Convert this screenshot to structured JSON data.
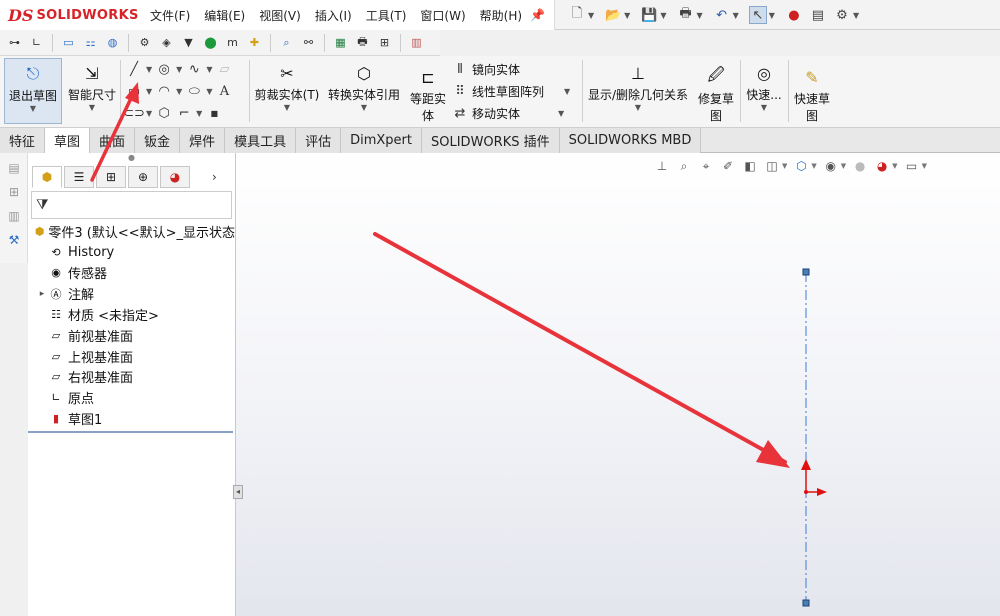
{
  "app": {
    "logo_mark": "DS",
    "logo_text": "SOLIDWORKS"
  },
  "menu": [
    "文件(F)",
    "编辑(E)",
    "视图(V)",
    "插入(I)",
    "工具(T)",
    "窗口(W)",
    "帮助(H)"
  ],
  "quick_access": [
    "new-document-icon",
    "open-icon",
    "save-icon",
    "print-icon",
    "undo-icon",
    "select-icon",
    "traffic-light-icon",
    "options-icon",
    "gear-icon"
  ],
  "toolbar2_icons": [
    "smart-dimension-icon",
    "sketch-icon",
    "monitor-icon",
    "tree-icon",
    "globe-icon",
    "gear-icon",
    "part-icon",
    "shadow-icon",
    "pin-icon",
    "graph-icon",
    "plus-icon",
    "zoom-icon",
    "binoculars-icon",
    "excel-icon",
    "print-icon",
    "add-icon",
    "document-icon"
  ],
  "command_manager": {
    "exit_sketch": "退出草图",
    "smart_dimension": "智能尺寸",
    "trim": "剪裁实体(T)",
    "convert": "转换实体引用",
    "offset_line1": "等距实",
    "offset_line2": "体",
    "mirror": "镜向实体",
    "linear_pattern": "线性草图阵列",
    "move": "移动实体",
    "display_relations": "显示/删除几何关系",
    "repair_line1": "修复草",
    "repair_line2": "图",
    "quick_snap": "快速...",
    "quick_sketch_line1": "快速草",
    "quick_sketch_line2": "图"
  },
  "tabs": [
    {
      "label": "特征",
      "active": false
    },
    {
      "label": "草图",
      "active": true
    },
    {
      "label": "曲面",
      "active": false
    },
    {
      "label": "钣金",
      "active": false
    },
    {
      "label": "焊件",
      "active": false
    },
    {
      "label": "模具工具",
      "active": false
    },
    {
      "label": "评估",
      "active": false
    },
    {
      "label": "DimXpert",
      "active": false
    },
    {
      "label": "SOLIDWORKS 插件",
      "active": false
    },
    {
      "label": "SOLIDWORKS MBD",
      "active": false
    }
  ],
  "feature_tree": {
    "filter_icon": "funnel-icon",
    "items": [
      {
        "label": "零件3  (默认<<默认>_显示状态",
        "icon": "part-icon",
        "expandable": false
      },
      {
        "label": "History",
        "icon": "history-icon",
        "expandable": false
      },
      {
        "label": "传感器",
        "icon": "sensor-icon",
        "expandable": false
      },
      {
        "label": "注解",
        "icon": "annotation-icon",
        "expandable": true
      },
      {
        "label": "材质 <未指定>",
        "icon": "material-icon",
        "expandable": false
      },
      {
        "label": "前视基准面",
        "icon": "plane-icon",
        "expandable": false
      },
      {
        "label": "上视基准面",
        "icon": "plane-icon",
        "expandable": false
      },
      {
        "label": "右视基准面",
        "icon": "plane-icon",
        "expandable": false
      },
      {
        "label": "原点",
        "icon": "origin-icon",
        "expandable": false
      },
      {
        "label": "草图1",
        "icon": "sketch-icon",
        "expandable": false
      }
    ]
  },
  "colors": {
    "accent": "#2a6cc7",
    "brand": "#d6232a",
    "annotation_arrow": "#e8333a",
    "centerline": "#3a7bd5",
    "origin": "#e01010"
  }
}
